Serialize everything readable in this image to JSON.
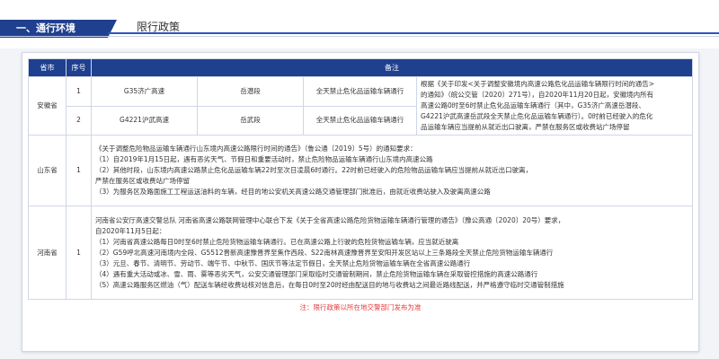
{
  "section": {
    "title": "一、通行环境",
    "page_title": "限行政策"
  },
  "table": {
    "headers": {
      "province": "省市",
      "seq": "序号",
      "remark": "备注"
    },
    "anhui": {
      "province": "安徽省",
      "rows": [
        {
          "seq": "1",
          "road": "G35济广高速",
          "segment": "岳潜段",
          "rule": "全天禁止危化品运输车辆通行"
        },
        {
          "seq": "2",
          "road": "G4221沪武高速",
          "segment": "岳武段",
          "rule": "全天禁止危化品运输车辆通行"
        }
      ],
      "note": [
        "根据《关于印发<关于调整安徽境内高速公路危化品运输车辆限行时间的通告>",
        "的通知》（皖公交管〔2020〕271号），自2020年11月20日起，安徽境内所有",
        "高速公路0时至6时禁止危化品运输车辆通行（其中，G35济广高速岳潜段、",
        "G4221沪武高速岳武段全天禁止危化品运输车辆通行）。0时前已经驶入的危化",
        "品运输车辆应当提前从就近出口驶离，严禁在服务区或收费站广场停留"
      ]
    },
    "shandong": {
      "province": "山东省",
      "seq": "1",
      "lines": [
        "《关于调整危险物品运输车辆通行山东境内高速公路限行时间的通告》（鲁公通〔2019〕5号）的通知要求：",
        "（1）自2019年1月15日起，遇有恶劣天气、节假日和重要活动时，禁止危险物品运输车辆通行山东境内高速公路",
        "（2）其他时段，山东境内高速公路禁止危化品运输车辆22时至次日凌晨6时通行。22时前已经驶入的危险物品运输车辆应当提前从就近出口驶离，",
        "严禁在服务区或收费站广场停留",
        "（3）为服务区及路面施工工程运送油料的车辆，经目的地公安机关高速公路交通管理部门批准后，由就近收费站驶入及驶离高速公路"
      ]
    },
    "henan": {
      "province": "河南省",
      "seq": "1",
      "lines": [
        "河南省公安厅高速交警总队 河南省高速公路联网管理中心联合下发《关于全省高速公路危险货物运输车辆通行管理的通告》（豫公高通〔2020〕20号）要求，",
        "自2020年11月5日起：",
        "（1）河南省高速公路每日0时至6时禁止危险货物运输车辆通行。已在高速公路上行驶的危险货物运输车辆，应当就近驶离",
        "（2）G59呼北高速河南境内全段、G5512晋新高速豫晋界至焦作西段、S22南林高速豫晋界至安阳开发区站以上三条路段全天禁止危险货物运输车辆通行",
        "（3）元旦、春节、清明节、劳动节、端午节、中秋节、国庆节等法定节假日，全天禁止危险货物运输车辆在全省高速公路通行",
        "（4）遇有重大活动或冰、雪、雨、雾等恶劣天气，公安交通管理部门采取临时交通管制期间，禁止危险货物运输车辆在采取管控措施的高速公路通行",
        "（5）高速公路服务区燃油（气）配送车辆经收费站核对信息后，在每日0时至20时经由配送目的地与收费站之间最近路线配送，并严格遵守临时交通管制措施"
      ]
    },
    "footnote": "注：限行政策以所在地交警部门发布为准"
  },
  "colors": {
    "primary": "#1f3f8f",
    "footnote": "#e23b3b"
  }
}
